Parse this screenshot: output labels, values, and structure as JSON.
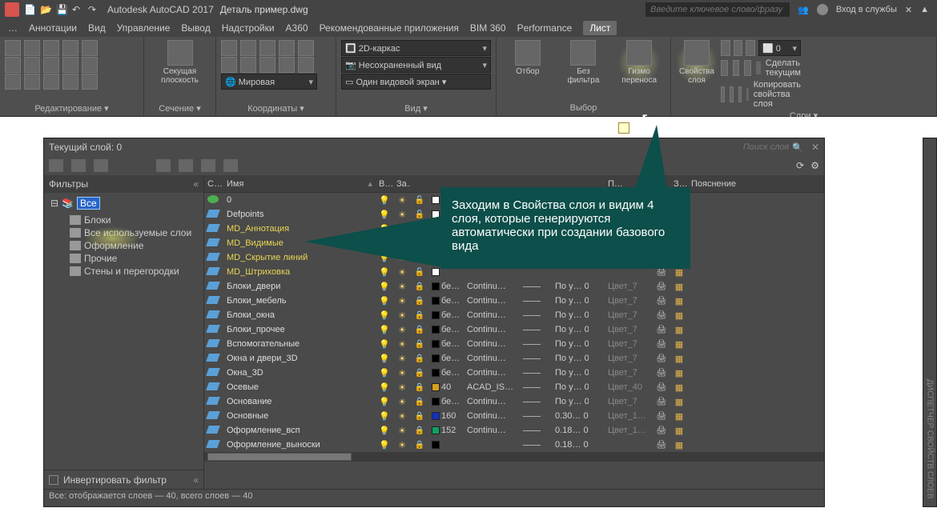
{
  "titlebar": {
    "appname": "Autodesk AutoCAD 2017",
    "docname": "Деталь пример.dwg",
    "search_placeholder": "Введите ключевое слово/фразу",
    "signin": "Вход в службы"
  },
  "tabs": [
    "…",
    "Аннотации",
    "Вид",
    "Управление",
    "Вывод",
    "Надстройки",
    "A360",
    "Рекомендованные приложения",
    "BIM 360",
    "Performance",
    "Лист"
  ],
  "active_tab": "Лист",
  "ribbon": {
    "panels": {
      "edit": "Редактирование ▾",
      "section_big": "Секущая плоскость",
      "section": "Сечение ▾",
      "coords": "Координаты ▾",
      "vstyle_combo": "2D-каркас",
      "savedview_combo": "Несохраненный вид",
      "world_label": "Мировая",
      "vport_label": "Один видовой экран  ▾",
      "view": "Вид ▾",
      "selpanel": "Выбор",
      "sel_otbor": "Отбор",
      "sel_filter": "Без фильтра",
      "sel_gizmo": "Гизмо переноса",
      "layers_label": "Свойства слоя",
      "layers_row1": "Сделать текущим",
      "layers_row2": "Копировать свойства слоя",
      "layers_panel": "Слои ▾",
      "layer_combo": "0"
    }
  },
  "layer_panel": {
    "title": "Текущий слой: 0",
    "search_placeholder": "Поиск слоя",
    "filters_header": "Фильтры",
    "filter_root": "Все",
    "filters": [
      "Блоки",
      "Все используемые слои",
      "Оформление",
      "Прочие",
      "Стены и перегородки"
    ],
    "invert": "Инвертировать фильтр",
    "columns": {
      "status": "С…",
      "name": "Имя",
      "on": "В…",
      "freeze": "За…",
      "lock": "",
      "color": "",
      "ltype": "",
      "lweight": "",
      "trans": "",
      "plot": "",
      "pstyle": "П…",
      "plot2": "З…",
      "desc": "Пояснение"
    },
    "rows": [
      {
        "current": true,
        "md": false,
        "name": "0",
        "on": true,
        "lock": false,
        "colorHex": "#ffffff",
        "color": "",
        "ltype": "",
        "lw": "",
        "trans": "",
        "pstyle": ""
      },
      {
        "current": false,
        "md": false,
        "name": "Defpoints",
        "on": true,
        "lock": false,
        "colorHex": "#ffffff",
        "color": "",
        "ltype": "",
        "lw": "",
        "trans": "",
        "pstyle": ""
      },
      {
        "current": false,
        "md": true,
        "name": "MD_Аннотация",
        "on": true,
        "lock": false,
        "colorHex": "#ffffff",
        "color": "",
        "ltype": "",
        "lw": "",
        "trans": "",
        "pstyle": ""
      },
      {
        "current": false,
        "md": true,
        "name": "MD_Видимые",
        "on": true,
        "lock": false,
        "colorHex": "#ffffff",
        "color": "",
        "ltype": "",
        "lw": "",
        "trans": "",
        "pstyle": ""
      },
      {
        "current": false,
        "md": true,
        "name": "MD_Скрытие линий",
        "on": true,
        "lock": false,
        "colorHex": "#ffffff",
        "color": "",
        "ltype": "",
        "lw": "",
        "trans": "",
        "pstyle": ""
      },
      {
        "current": false,
        "md": true,
        "name": "MD_Штриховка",
        "on": true,
        "lock": false,
        "colorHex": "#ffffff",
        "color": "",
        "ltype": "",
        "lw": "",
        "trans": "",
        "pstyle": ""
      },
      {
        "current": false,
        "md": false,
        "name": "Блоки_двери",
        "on": true,
        "lock": true,
        "colorHex": "#000000",
        "color": "бе…",
        "ltype": "Continu…",
        "lw": "—",
        "trans": "По у…  0",
        "pstyle": "Цвет_7"
      },
      {
        "current": false,
        "md": false,
        "name": "Блоки_мебель",
        "on": true,
        "lock": true,
        "colorHex": "#000000",
        "color": "бе…",
        "ltype": "Continu…",
        "lw": "—",
        "trans": "По у…  0",
        "pstyle": "Цвет_7"
      },
      {
        "current": false,
        "md": false,
        "name": "Блоки_окна",
        "on": true,
        "lock": true,
        "colorHex": "#000000",
        "color": "бе…",
        "ltype": "Continu…",
        "lw": "—",
        "trans": "По у…  0",
        "pstyle": "Цвет_7"
      },
      {
        "current": false,
        "md": false,
        "name": "Блоки_прочее",
        "on": true,
        "lock": true,
        "colorHex": "#000000",
        "color": "бе…",
        "ltype": "Continu…",
        "lw": "—",
        "trans": "По у…  0",
        "pstyle": "Цвет_7"
      },
      {
        "current": false,
        "md": false,
        "name": "Вспомогательные",
        "on": true,
        "lock": true,
        "colorHex": "#000000",
        "color": "бе…",
        "ltype": "Continu…",
        "lw": "—",
        "trans": "По у…  0",
        "pstyle": "Цвет_7"
      },
      {
        "current": false,
        "md": false,
        "name": "Окна и двери_3D",
        "on": true,
        "lock": true,
        "colorHex": "#000000",
        "color": "бе…",
        "ltype": "Continu…",
        "lw": "—",
        "trans": "По у…  0",
        "pstyle": "Цвет_7"
      },
      {
        "current": false,
        "md": false,
        "name": "Окна_3D",
        "on": true,
        "lock": true,
        "colorHex": "#000000",
        "color": "бе…",
        "ltype": "Continu…",
        "lw": "—",
        "trans": "По у…  0",
        "pstyle": "Цвет_7"
      },
      {
        "current": false,
        "md": false,
        "name": "Осевые",
        "on": true,
        "lock": true,
        "colorHex": "#d8a020",
        "color": "40",
        "ltype": "ACAD_IS…",
        "lw": "—",
        "trans": "По у…  0",
        "pstyle": "Цвет_40"
      },
      {
        "current": false,
        "md": false,
        "name": "Основание",
        "on": true,
        "lock": true,
        "colorHex": "#000000",
        "color": "бе…",
        "ltype": "Continu…",
        "lw": "—",
        "trans": "По у…  0",
        "pstyle": "Цвет_7"
      },
      {
        "current": false,
        "md": false,
        "name": "Основные",
        "on": true,
        "lock": true,
        "colorHex": "#1030c0",
        "color": "160",
        "ltype": "Continu…",
        "lw": "—",
        "trans": "0.30…  0",
        "pstyle": "Цвет_1…"
      },
      {
        "current": false,
        "md": false,
        "name": "Оформление_всп",
        "on": true,
        "lock": true,
        "colorHex": "#10a060",
        "color": "152",
        "ltype": "Continu…",
        "lw": "—",
        "trans": "0.18…  0",
        "pstyle": "Цвет_1…"
      },
      {
        "current": false,
        "md": false,
        "name": "Оформление_выноски",
        "on": true,
        "lock": true,
        "colorHex": "#000000",
        "color": "",
        "ltype": "",
        "lw": "—",
        "trans": "0.18…  0",
        "pstyle": ""
      }
    ],
    "status": "Все: отображается слоев — 40, всего слоев — 40",
    "side_label": "ДИСПЕТЧЕР СВОЙСТВ СЛОЕВ"
  },
  "callout": "Заходим в Свойства слоя и видим 4 слоя, которые генерируются автоматически при создании базового вида"
}
